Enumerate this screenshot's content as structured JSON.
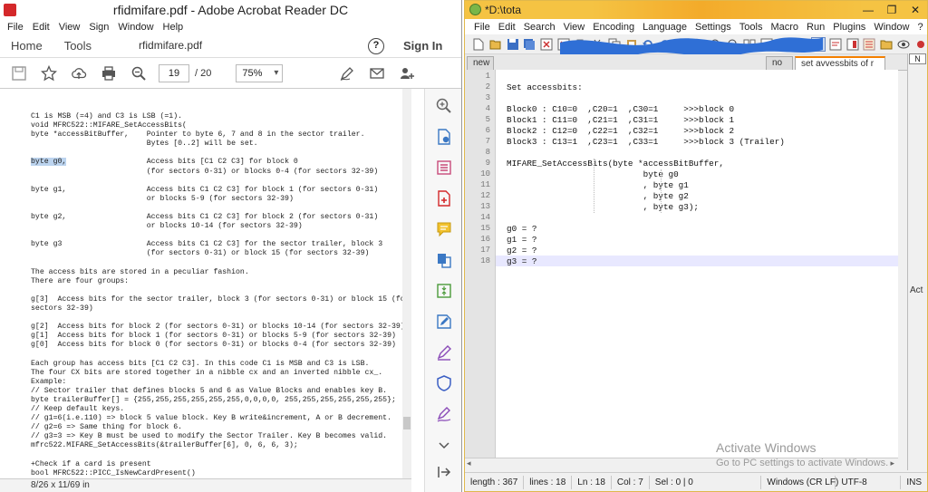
{
  "acrobat": {
    "title": "rfidmifare.pdf - Adobe Acrobat Reader DC",
    "menu": [
      "File",
      "Edit",
      "View",
      "Sign",
      "Window",
      "Help"
    ],
    "nav": {
      "home": "Home",
      "tools": "Tools",
      "tab": "rfidmifare.pdf",
      "help": "?",
      "signin": "Sign In"
    },
    "toolbar": {
      "page_current": "19",
      "page_total": "/  20",
      "zoom": "75%"
    },
    "doc_lines_pre": [
      "C1 is MSB (=4) and C3 is LSB (=1).",
      "void MFRC522::MIFARE_SetAccessBits(",
      "byte *accessBitBuffer,    Pointer to byte 6, 7 and 8 in the sector trailer.",
      "                          Bytes [0..2] will be set.",
      ""
    ],
    "doc_highlight": "byte g0,",
    "doc_highlight_rest": "                  Access bits [C1 C2 C3] for block 0",
    "doc_lines_post": [
      "                          (for sectors 0-31) or blocks 0-4 (for sectors 32-39)",
      "",
      "byte g1,                  Access bits C1 C2 C3] for block 1 (for sectors 0-31)",
      "                          or blocks 5-9 (for sectors 32-39)",
      "",
      "byte g2,                  Access bits C1 C2 C3] for block 2 (for sectors 0-31)",
      "                          or blocks 10-14 (for sectors 32-39)",
      "",
      "byte g3                   Access bits C1 C2 C3] for the sector trailer, block 3",
      "                          (for sectors 0-31) or block 15 (for sectors 32-39)",
      "",
      "The access bits are stored in a peculiar fashion.",
      "There are four groups:",
      "",
      "g[3]  Access bits for the sector trailer, block 3 (for sectors 0-31) or block 15 (for",
      "sectors 32-39)",
      "",
      "g[2]  Access bits for block 2 (for sectors 0-31) or blocks 10-14 (for sectors 32-39)",
      "g[1]  Access bits for block 1 (for sectors 0-31) or blocks 5-9 (for sectors 32-39)",
      "g[0]  Access bits for block 0 (for sectors 0-31) or blocks 0-4 (for sectors 32-39)",
      "",
      "Each group has access bits [C1 C2 C3]. In this code C1 is MSB and C3 is LSB.",
      "The four CX bits are stored together in a nibble cx and an inverted nibble cx_.",
      "Example:",
      "// Sector trailer that defines blocks 5 and 6 as Value Blocks and enables key B.",
      "byte trailerBuffer[] = {255,255,255,255,255,255,0,0,0,0, 255,255,255,255,255,255};",
      "// Keep default keys.",
      "// g1=6(i.e.110) => block 5 value block. Key B write&increment, A or B decrement.",
      "// g2=6 => Same thing for block 6.",
      "// g3=3 => Key B must be used to modify the Sector Trailer. Key B becomes valid.",
      "mfrc522.MIFARE_SetAccessBits(&trailerBuffer[6], 0, 6, 6, 3);",
      "",
      "+Check if a card is present",
      "bool MFRC522::PICC_IsNewCardPresent()"
    ],
    "status": "8/26 x 11/69 in"
  },
  "npp": {
    "title": "*D:\\tota",
    "menu": [
      "File",
      "Edit",
      "Search",
      "View",
      "Encoding",
      "Language",
      "Settings",
      "Tools",
      "Macro",
      "Run",
      "Plugins",
      "Window",
      "?"
    ],
    "tabs": [
      {
        "label": "new",
        "active": false
      },
      {
        "label": "no",
        "active": false
      },
      {
        "label": "set avvessbits of r",
        "active": true
      }
    ],
    "side_label": "N",
    "side_panel_label": "Act",
    "lines": [
      "",
      "Set accessbits:",
      "",
      "Block0 : C10=0  ,C20=1  ,C30=1     >>>block 0",
      "Block1 : C11=0  ,C21=1  ,C31=1     >>>block 1",
      "Block2 : C12=0  ,C22=1  ,C32=1     >>>block 2",
      "Block3 : C13=1  ,C23=1  ,C33=1     >>>block 3 (Trailer)",
      "",
      "MIFARE_SetAccessBits(byte *accessBitBuffer,",
      "                           byte g0",
      "                           , byte g1",
      "                           , byte g2",
      "                           , byte g3);",
      "",
      "g0 = ?",
      "g1 = ?",
      "g2 = ?",
      "g3 = ?"
    ],
    "status": {
      "length": "length : 367",
      "lines": "lines : 18",
      "ln": "Ln : 18",
      "col": "Col : 7",
      "sel": "Sel : 0 | 0",
      "eol": "Windows (CR LF)",
      "encoding": "UTF-8",
      "mode": "INS"
    }
  },
  "activate": {
    "line1": "Activate Windows",
    "line2": "Go to PC settings to activate Windows."
  },
  "colors": {
    "npp_title": "#f5c343",
    "acrobat_red": "#d4282a",
    "redaction": "#2f6fd6"
  }
}
